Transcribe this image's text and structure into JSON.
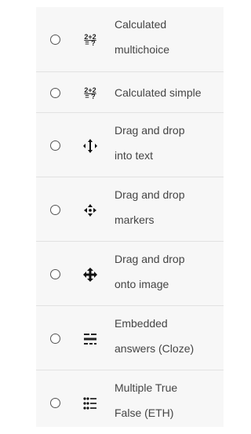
{
  "question_types": [
    {
      "label_line1": "Calculated",
      "label_line2": "multichoice",
      "icon": "calculated-icon",
      "icon_text_top": "2+2",
      "icon_text_bottom": "= ?"
    },
    {
      "label_line1": "Calculated simple",
      "label_line2": "",
      "icon": "calculated-simple-icon",
      "icon_text_top": "2+2",
      "icon_text_bottom": "= ?"
    },
    {
      "label_line1": "Drag and drop",
      "label_line2": "into text",
      "icon": "drag-drop-text-icon"
    },
    {
      "label_line1": "Drag and drop",
      "label_line2": "markers",
      "icon": "drag-drop-markers-icon"
    },
    {
      "label_line1": "Drag and drop",
      "label_line2": "onto image",
      "icon": "drag-drop-image-icon"
    },
    {
      "label_line1": "Embedded",
      "label_line2": "answers (Cloze)",
      "icon": "cloze-icon"
    },
    {
      "label_line1": "Multiple True",
      "label_line2": "False (ETH)",
      "icon": "multiple-true-false-icon"
    }
  ]
}
